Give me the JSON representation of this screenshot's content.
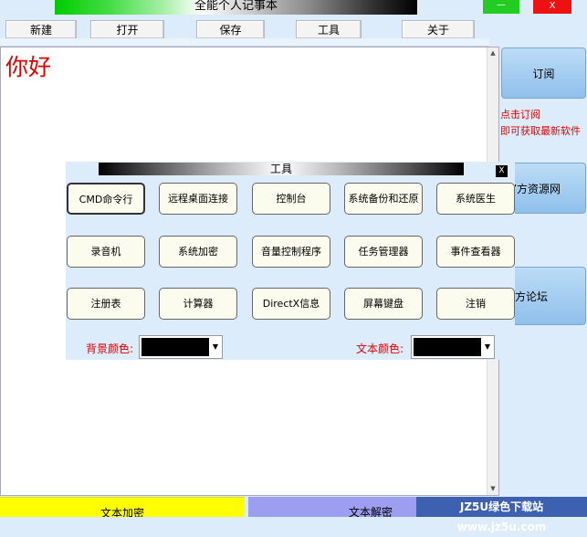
{
  "window": {
    "title": "全能个人记事本",
    "minimize_label": "—",
    "close_label": "X"
  },
  "toolbar": {
    "new_label": "新建",
    "open_label": "打开",
    "save_label": "保存",
    "tools_label": "工具",
    "about_label": "关于"
  },
  "editor": {
    "content": "你好",
    "text_color": "#e00000"
  },
  "side_panel": {
    "subscribe_label": "订阅",
    "promo_line1": "点击订阅",
    "promo_line2": "即可获取最新软件",
    "resources_label": "进入官方资源网",
    "forum_label": "进入官方论坛"
  },
  "bottom": {
    "encrypt_label": "文本加密",
    "decrypt_label": "文本解密",
    "watermark": "JZ5U绿色下载站www.jz5u.com"
  },
  "tools_dialog": {
    "title": "工具",
    "close_label": "X",
    "buttons": [
      "CMD命令行",
      "远程桌面连接",
      "控制台",
      "系统备份和还原",
      "系统医生",
      "录音机",
      "系统加密",
      "音量控制程序",
      "任务管理器",
      "事件查看器",
      "注册表",
      "计算器",
      "DirectX信息",
      "屏幕键盘",
      "注销"
    ],
    "bg_color_label": "背景颜色:",
    "text_color_label": "文本颜色:",
    "bg_color_value": "#000000",
    "text_color_value": "#000000"
  },
  "icons": {
    "scroll_up": "scroll-up-arrow-icon",
    "scroll_down": "scroll-down-arrow-icon",
    "dropdown": "dropdown-arrow-icon"
  }
}
